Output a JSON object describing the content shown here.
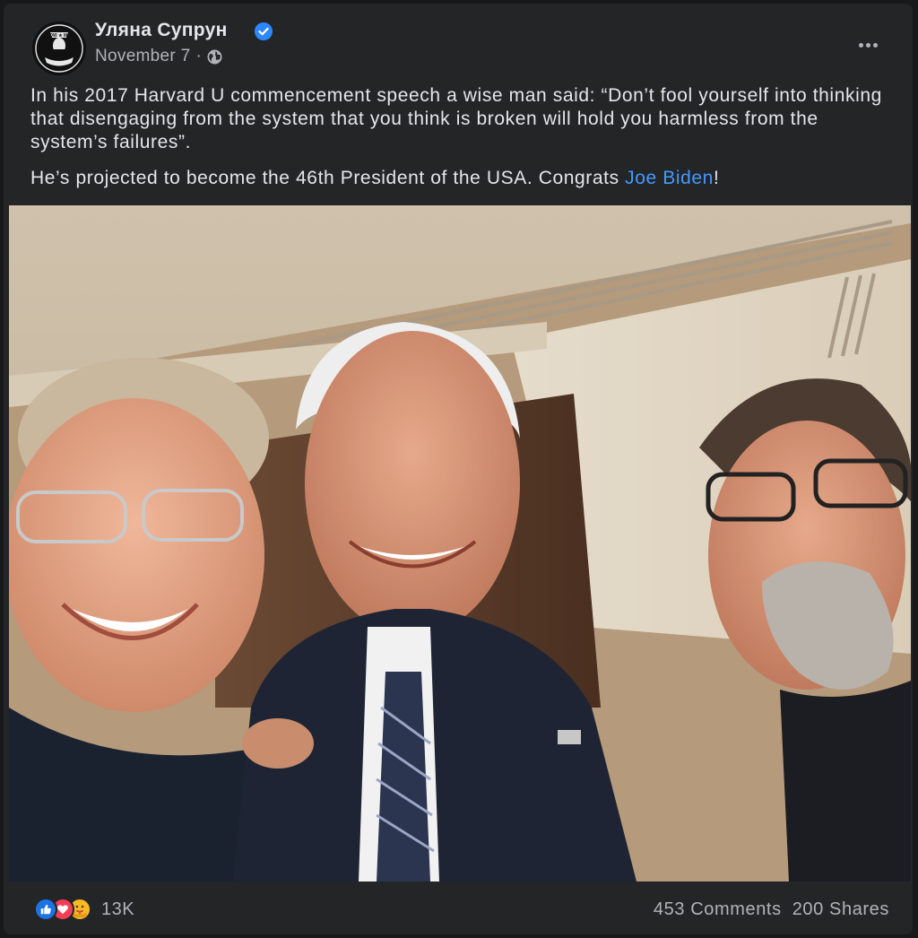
{
  "post": {
    "author": "Уляна Супрун",
    "date": "November 7",
    "separator": "·",
    "privacy_icon": "globe-icon",
    "verified_icon": "verified-badge-icon",
    "paragraph_1": "In his 2017 Harvard U commencement speech a wise man said: “Don’t fool yourself into thinking that disengaging from the system that you think is broken will hold you harmless from the system’s failures”.",
    "paragraph_2_before": "He’s projected to become the 46th President of the USA. Congrats ",
    "paragraph_2_link": "Joe Biden",
    "paragraph_2_after": "!",
    "avatar_text_top": "POW ★ MIA",
    "avatar_text_bottom": "YOU ARE NOT FORGOTTEN"
  },
  "footer": {
    "reaction_icons": [
      "like-icon",
      "love-icon",
      "care-icon"
    ],
    "reaction_count": "13K",
    "comments": "453 Comments",
    "shares": "200 Shares"
  },
  "colors": {
    "background": "#18191a",
    "card": "#242526",
    "primary_text": "#e4e6eb",
    "secondary_text": "#b0b3b8",
    "link": "#4599ff",
    "verified": "#2d88ff"
  }
}
